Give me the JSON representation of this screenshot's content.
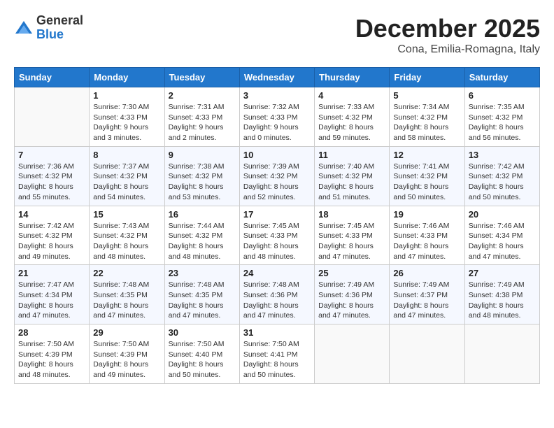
{
  "logo": {
    "general": "General",
    "blue": "Blue"
  },
  "title": "December 2025",
  "location": "Cona, Emilia-Romagna, Italy",
  "weekdays": [
    "Sunday",
    "Monday",
    "Tuesday",
    "Wednesday",
    "Thursday",
    "Friday",
    "Saturday"
  ],
  "weeks": [
    [
      {
        "day": "",
        "sunrise": "",
        "sunset": "",
        "daylight": ""
      },
      {
        "day": "1",
        "sunrise": "Sunrise: 7:30 AM",
        "sunset": "Sunset: 4:33 PM",
        "daylight": "Daylight: 9 hours and 3 minutes."
      },
      {
        "day": "2",
        "sunrise": "Sunrise: 7:31 AM",
        "sunset": "Sunset: 4:33 PM",
        "daylight": "Daylight: 9 hours and 2 minutes."
      },
      {
        "day": "3",
        "sunrise": "Sunrise: 7:32 AM",
        "sunset": "Sunset: 4:33 PM",
        "daylight": "Daylight: 9 hours and 0 minutes."
      },
      {
        "day": "4",
        "sunrise": "Sunrise: 7:33 AM",
        "sunset": "Sunset: 4:32 PM",
        "daylight": "Daylight: 8 hours and 59 minutes."
      },
      {
        "day": "5",
        "sunrise": "Sunrise: 7:34 AM",
        "sunset": "Sunset: 4:32 PM",
        "daylight": "Daylight: 8 hours and 58 minutes."
      },
      {
        "day": "6",
        "sunrise": "Sunrise: 7:35 AM",
        "sunset": "Sunset: 4:32 PM",
        "daylight": "Daylight: 8 hours and 56 minutes."
      }
    ],
    [
      {
        "day": "7",
        "sunrise": "Sunrise: 7:36 AM",
        "sunset": "Sunset: 4:32 PM",
        "daylight": "Daylight: 8 hours and 55 minutes."
      },
      {
        "day": "8",
        "sunrise": "Sunrise: 7:37 AM",
        "sunset": "Sunset: 4:32 PM",
        "daylight": "Daylight: 8 hours and 54 minutes."
      },
      {
        "day": "9",
        "sunrise": "Sunrise: 7:38 AM",
        "sunset": "Sunset: 4:32 PM",
        "daylight": "Daylight: 8 hours and 53 minutes."
      },
      {
        "day": "10",
        "sunrise": "Sunrise: 7:39 AM",
        "sunset": "Sunset: 4:32 PM",
        "daylight": "Daylight: 8 hours and 52 minutes."
      },
      {
        "day": "11",
        "sunrise": "Sunrise: 7:40 AM",
        "sunset": "Sunset: 4:32 PM",
        "daylight": "Daylight: 8 hours and 51 minutes."
      },
      {
        "day": "12",
        "sunrise": "Sunrise: 7:41 AM",
        "sunset": "Sunset: 4:32 PM",
        "daylight": "Daylight: 8 hours and 50 minutes."
      },
      {
        "day": "13",
        "sunrise": "Sunrise: 7:42 AM",
        "sunset": "Sunset: 4:32 PM",
        "daylight": "Daylight: 8 hours and 50 minutes."
      }
    ],
    [
      {
        "day": "14",
        "sunrise": "Sunrise: 7:42 AM",
        "sunset": "Sunset: 4:32 PM",
        "daylight": "Daylight: 8 hours and 49 minutes."
      },
      {
        "day": "15",
        "sunrise": "Sunrise: 7:43 AM",
        "sunset": "Sunset: 4:32 PM",
        "daylight": "Daylight: 8 hours and 48 minutes."
      },
      {
        "day": "16",
        "sunrise": "Sunrise: 7:44 AM",
        "sunset": "Sunset: 4:32 PM",
        "daylight": "Daylight: 8 hours and 48 minutes."
      },
      {
        "day": "17",
        "sunrise": "Sunrise: 7:45 AM",
        "sunset": "Sunset: 4:33 PM",
        "daylight": "Daylight: 8 hours and 48 minutes."
      },
      {
        "day": "18",
        "sunrise": "Sunrise: 7:45 AM",
        "sunset": "Sunset: 4:33 PM",
        "daylight": "Daylight: 8 hours and 47 minutes."
      },
      {
        "day": "19",
        "sunrise": "Sunrise: 7:46 AM",
        "sunset": "Sunset: 4:33 PM",
        "daylight": "Daylight: 8 hours and 47 minutes."
      },
      {
        "day": "20",
        "sunrise": "Sunrise: 7:46 AM",
        "sunset": "Sunset: 4:34 PM",
        "daylight": "Daylight: 8 hours and 47 minutes."
      }
    ],
    [
      {
        "day": "21",
        "sunrise": "Sunrise: 7:47 AM",
        "sunset": "Sunset: 4:34 PM",
        "daylight": "Daylight: 8 hours and 47 minutes."
      },
      {
        "day": "22",
        "sunrise": "Sunrise: 7:48 AM",
        "sunset": "Sunset: 4:35 PM",
        "daylight": "Daylight: 8 hours and 47 minutes."
      },
      {
        "day": "23",
        "sunrise": "Sunrise: 7:48 AM",
        "sunset": "Sunset: 4:35 PM",
        "daylight": "Daylight: 8 hours and 47 minutes."
      },
      {
        "day": "24",
        "sunrise": "Sunrise: 7:48 AM",
        "sunset": "Sunset: 4:36 PM",
        "daylight": "Daylight: 8 hours and 47 minutes."
      },
      {
        "day": "25",
        "sunrise": "Sunrise: 7:49 AM",
        "sunset": "Sunset: 4:36 PM",
        "daylight": "Daylight: 8 hours and 47 minutes."
      },
      {
        "day": "26",
        "sunrise": "Sunrise: 7:49 AM",
        "sunset": "Sunset: 4:37 PM",
        "daylight": "Daylight: 8 hours and 47 minutes."
      },
      {
        "day": "27",
        "sunrise": "Sunrise: 7:49 AM",
        "sunset": "Sunset: 4:38 PM",
        "daylight": "Daylight: 8 hours and 48 minutes."
      }
    ],
    [
      {
        "day": "28",
        "sunrise": "Sunrise: 7:50 AM",
        "sunset": "Sunset: 4:39 PM",
        "daylight": "Daylight: 8 hours and 48 minutes."
      },
      {
        "day": "29",
        "sunrise": "Sunrise: 7:50 AM",
        "sunset": "Sunset: 4:39 PM",
        "daylight": "Daylight: 8 hours and 49 minutes."
      },
      {
        "day": "30",
        "sunrise": "Sunrise: 7:50 AM",
        "sunset": "Sunset: 4:40 PM",
        "daylight": "Daylight: 8 hours and 50 minutes."
      },
      {
        "day": "31",
        "sunrise": "Sunrise: 7:50 AM",
        "sunset": "Sunset: 4:41 PM",
        "daylight": "Daylight: 8 hours and 50 minutes."
      },
      {
        "day": "",
        "sunrise": "",
        "sunset": "",
        "daylight": ""
      },
      {
        "day": "",
        "sunrise": "",
        "sunset": "",
        "daylight": ""
      },
      {
        "day": "",
        "sunrise": "",
        "sunset": "",
        "daylight": ""
      }
    ]
  ]
}
